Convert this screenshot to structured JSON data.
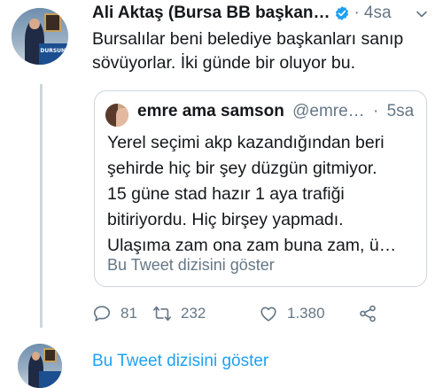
{
  "tweet": {
    "author_name": "Ali Aktaş (Bursa BB başkan…",
    "separator": "·",
    "time": "4sa",
    "text": "Bursalılar beni belediye başkanları sanıp sövüyorlar. İki günde bir oluyor bu.",
    "avatar_label": "DURSUN"
  },
  "quote": {
    "author_name": "emre ama samson",
    "handle": "@emre…",
    "separator": "·",
    "time": "5sa",
    "text": "Yerel seçimi akp kazandığından beri\nşehirde hiç bir şey düzgün gitmiyor.\n15 güne stad hazır 1 aya trafiği\nbitiriyordu. Hiç birşey yapmadı.\nUlaşıma zam ona zam buna zam, ü…",
    "show_thread": "Bu Tweet dizisini göster"
  },
  "actions": {
    "replies": "81",
    "retweets": "232",
    "likes": "1.380"
  },
  "show_thread": "Bu Tweet dizisini göster",
  "colors": {
    "accent": "#1da1f2",
    "muted": "#657786",
    "border": "#ccd6dd"
  },
  "icons": [
    "verified-icon",
    "caret-down-icon",
    "reply-icon",
    "retweet-icon",
    "like-icon",
    "share-icon"
  ]
}
